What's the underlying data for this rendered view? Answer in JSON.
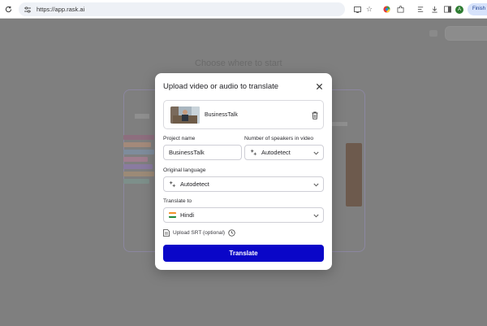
{
  "browser": {
    "url": "https://app.rask.ai",
    "profile_initial": "A",
    "finish_label": "Finish u"
  },
  "background": {
    "title": "Choose where to start"
  },
  "modal": {
    "title": "Upload video or audio to translate",
    "file": {
      "name": "BusinessTalk"
    },
    "project_name": {
      "label": "Project name",
      "value": "BusinessTalk"
    },
    "speakers": {
      "label": "Number of speakers in video",
      "value": "Autodetect"
    },
    "original_language": {
      "label": "Original language",
      "value": "Autodetect"
    },
    "translate_to": {
      "label": "Translate to",
      "value": "Hindi"
    },
    "upload_srt_label": "Upload SRT (optional)",
    "translate_button": "Translate"
  },
  "colors": {
    "accent": "#0a06c8",
    "overlay": "#7f7f7f"
  }
}
